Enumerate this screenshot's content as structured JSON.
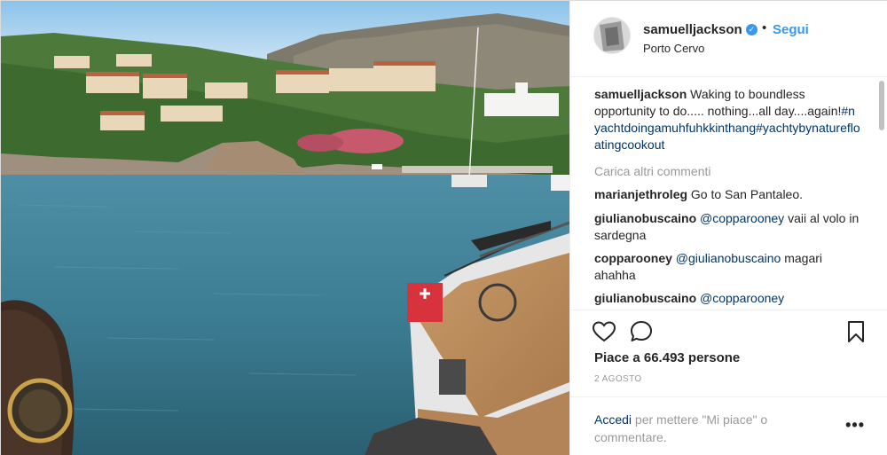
{
  "post": {
    "username": "samuelljackson",
    "follow_label": "Segui",
    "separator": "•",
    "location": "Porto Cervo",
    "verified_icon": "verified-badge-icon"
  },
  "caption": {
    "username": "samuelljackson",
    "text": "Waking to boundless opportunity to do..... nothing...all day....again!",
    "hashtags": "#nyachtdoingamuhfuhkkinthang#yachtybynaturefloatingcookout"
  },
  "load_more_label": "Carica altri commenti",
  "comments": [
    {
      "username": "marianjethroleg",
      "mention": "",
      "text": "Go to San Pantaleo."
    },
    {
      "username": "giulianobuscaino",
      "mention": "@copparooney",
      "text": "vaii al volo in sardegna"
    },
    {
      "username": "copparooney",
      "mention": "@giulianobuscaino",
      "text": "magari ahahha"
    },
    {
      "username": "giulianobuscaino",
      "mention": "@copparooney",
      "text": ""
    }
  ],
  "actions": {
    "like_icon": "heart-icon",
    "comment_icon": "comment-icon",
    "save_icon": "bookmark-icon"
  },
  "likes_text": "Piace a 66.493 persone",
  "date_text": "2 AGOSTO",
  "add_comment": {
    "login_link": "Accedi",
    "text": "per mettere \"Mi piace\" o commentare.",
    "more_icon": "more-options-icon",
    "more_label": "•••"
  },
  "colors": {
    "accent": "#3897f0",
    "link": "#003569",
    "muted": "#999999",
    "text": "#262626"
  }
}
